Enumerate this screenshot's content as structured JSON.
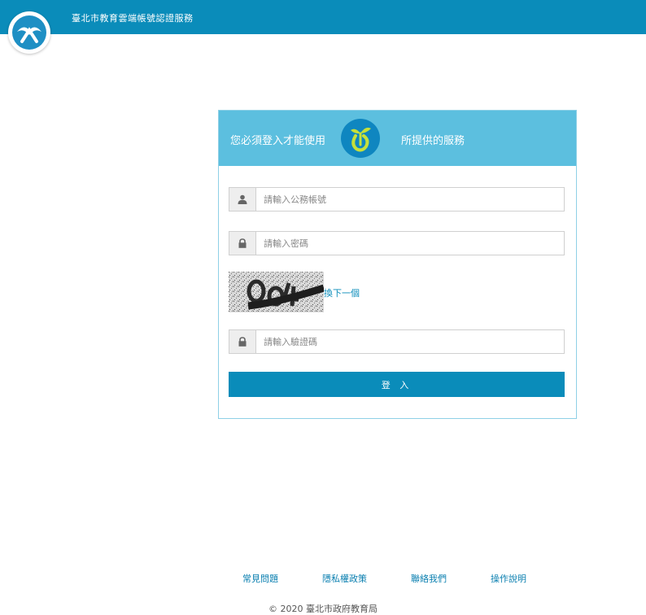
{
  "header": {
    "title": "臺北市教育雲端帳號認證服務",
    "logo_icon": "taipei-edu-logo-icon",
    "brand_color": "#0a8cba"
  },
  "login": {
    "heading_before": "您必須登入才能使用",
    "heading_after": "所提供的服務",
    "app_logo_icon": "app-sprout-logo-icon",
    "header_color": "#5cbfdf",
    "username_placeholder": "請輸入公務帳號",
    "password_placeholder": "請輸入密碼",
    "captcha_refresh": "換下一個",
    "captcha_code_placeholder": "請輸入驗證碼",
    "submit_label": "登 入"
  },
  "footer": {
    "links": [
      "常見問題",
      "隱私權政策",
      "聯絡我們",
      "操作說明"
    ],
    "copyright": "© 2020 臺北市政府教育局"
  }
}
